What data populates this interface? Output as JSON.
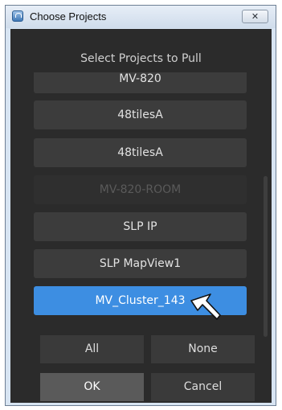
{
  "window": {
    "title": "Choose Projects",
    "close_symbol": "✕"
  },
  "dialog": {
    "heading": "Select Projects to Pull",
    "projects": [
      {
        "label": "MV-820",
        "state": "normal"
      },
      {
        "label": "48tilesA",
        "state": "normal"
      },
      {
        "label": "48tilesA",
        "state": "normal"
      },
      {
        "label": "MV-820-ROOM",
        "state": "disabled"
      },
      {
        "label": "SLP IP",
        "state": "normal"
      },
      {
        "label": "SLP MapView1",
        "state": "normal"
      },
      {
        "label": "MV_Cluster_143",
        "state": "selected"
      }
    ],
    "buttons": {
      "all": "All",
      "none": "None",
      "ok": "OK",
      "cancel": "Cancel"
    }
  },
  "colors": {
    "selected": "#3d8ee2",
    "background": "#2b2b2b"
  },
  "icons": {
    "app": "app-icon",
    "close": "close-icon",
    "pointer": "mouse-cursor-icon"
  }
}
